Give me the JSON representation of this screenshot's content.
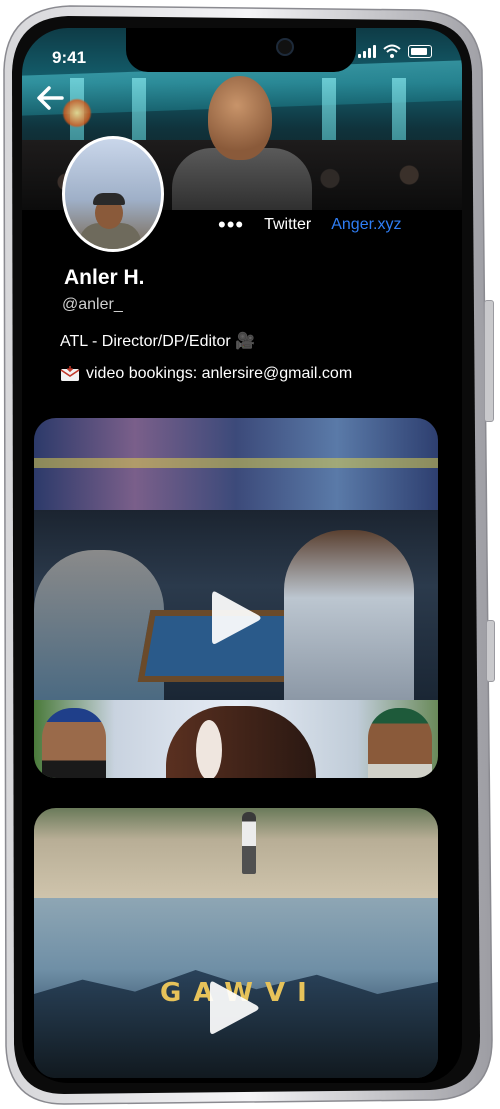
{
  "status_bar": {
    "time": "9:41"
  },
  "profile": {
    "name": "Anler H.",
    "handle": "@anler_",
    "bio_line1": "ATL - Director/DP/Editor 🎥",
    "bio_line2": "video bookings: anlersire@gmail.com"
  },
  "links": {
    "more": "•••",
    "twitter": "Twitter",
    "website": "Anger.xyz"
  },
  "videos": [
    {
      "title": "",
      "overlay_text": ""
    },
    {
      "title": "",
      "overlay_text": "GAWVI"
    }
  ],
  "colors": {
    "screen_bg": "#000000",
    "link_accent": "#2f7ef5",
    "text_primary": "#ffffff",
    "text_secondary": "#cfcfcf"
  },
  "icons": [
    "back-arrow-icon",
    "signal-icon",
    "wifi-icon",
    "battery-icon",
    "more-icon",
    "envelope-icon",
    "play-icon"
  ]
}
